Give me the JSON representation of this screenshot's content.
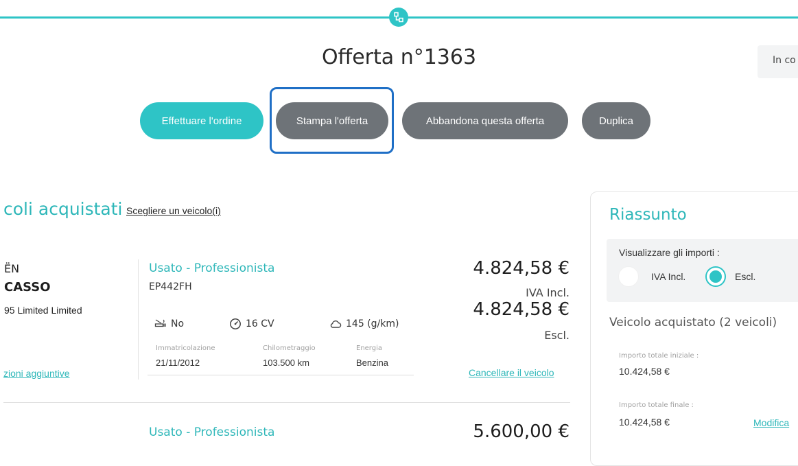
{
  "page": {
    "title": "Offerta n°1363",
    "status_text": "In co"
  },
  "actions": {
    "order": "Effettuare l'ordine",
    "print": "Stampa l'offerta",
    "abandon": "Abbandona questa offerta",
    "duplicate": "Duplica"
  },
  "vehicles_section": {
    "title": "coli acquistati",
    "choose_link": "Scegliere un veicolo(i)"
  },
  "vehicle_1": {
    "brand": "ËN",
    "model": "CASSO",
    "version": "95 Limited Limited",
    "options_link": "zioni aggiuntive",
    "category": "Usato - Professionista",
    "plate": "EP442FH",
    "specs": [
      {
        "icon": "no-smoking-icon",
        "value": "No"
      },
      {
        "icon": "speedometer-icon",
        "value": "16 CV"
      },
      {
        "icon": "cloud-icon",
        "value": "145 (g/km)"
      }
    ],
    "details": [
      {
        "label": "Immatricolazione",
        "value": "21/11/2012"
      },
      {
        "label": "Chilometraggio",
        "value": "103.500 km"
      },
      {
        "label": "Energia",
        "value": "Benzina"
      }
    ],
    "price_incl": "4.824,58 €",
    "price_incl_note": "IVA Incl.",
    "price_excl": "4.824,58 €",
    "price_excl_note": "Escl.",
    "cancel_link": "Cancellare il veicolo"
  },
  "vehicle_2": {
    "category": "Usato - Professionista",
    "price_incl": "5.600,00 €"
  },
  "summary": {
    "title": "Riassunto",
    "display_label": "Visualizzare gli importi :",
    "option_incl": "IVA Incl.",
    "option_excl": "Escl.",
    "selected": "Escl.",
    "vehicles_count": "Veicolo acquistato (2 veicoli)",
    "initial_label": "Importo totale iniziale :",
    "initial_value": "10.424,58 €",
    "final_label": "Importo totale finale :",
    "final_value": "10.424,58 €",
    "modify_link": "Modifica"
  },
  "colors": {
    "accent": "#2ec4c6",
    "secondary_button": "#6e7378",
    "highlight": "#1f6fc6"
  }
}
